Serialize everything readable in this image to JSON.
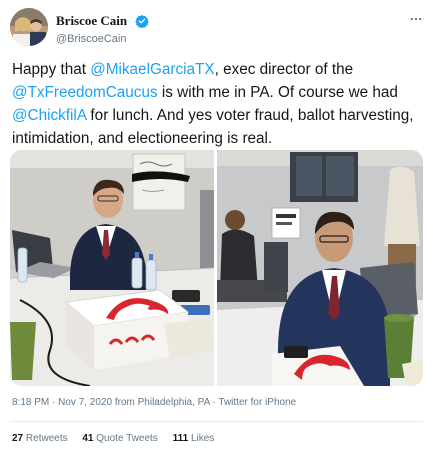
{
  "user": {
    "display_name": "Briscoe Cain",
    "handle": "@BriscoeCain",
    "verified_icon": "verified-badge-icon",
    "accent": "#1da1f2"
  },
  "tweet": {
    "segments": [
      {
        "text": "Happy that ",
        "link": false
      },
      {
        "text": "@MikaelGarciaTX",
        "link": true
      },
      {
        "text": ", exec director of the ",
        "link": false
      },
      {
        "text": "@TxFreedomCaucus",
        "link": true
      },
      {
        "text": " is with me in PA. Of course we had ",
        "link": false
      },
      {
        "text": "@ChickfilA",
        "link": true
      },
      {
        "text": " for lunch. And yes voter fraud, ballot harvesting, intimidation, and electioneering is real.",
        "link": false
      }
    ],
    "timestamp": "8:18 PM · Nov 7, 2020 from Philadelphia, PA · Twitter for iPhone"
  },
  "stats": {
    "retweets_count": "27",
    "retweets_label": "Retweets",
    "quotes_count": "41",
    "quotes_label": "Quote Tweets",
    "likes_count": "111",
    "likes_label": "Likes"
  },
  "colors": {
    "text": "#14171a",
    "secondary": "#657786",
    "link": "#1da1f2",
    "divider": "#e6ecf0"
  }
}
